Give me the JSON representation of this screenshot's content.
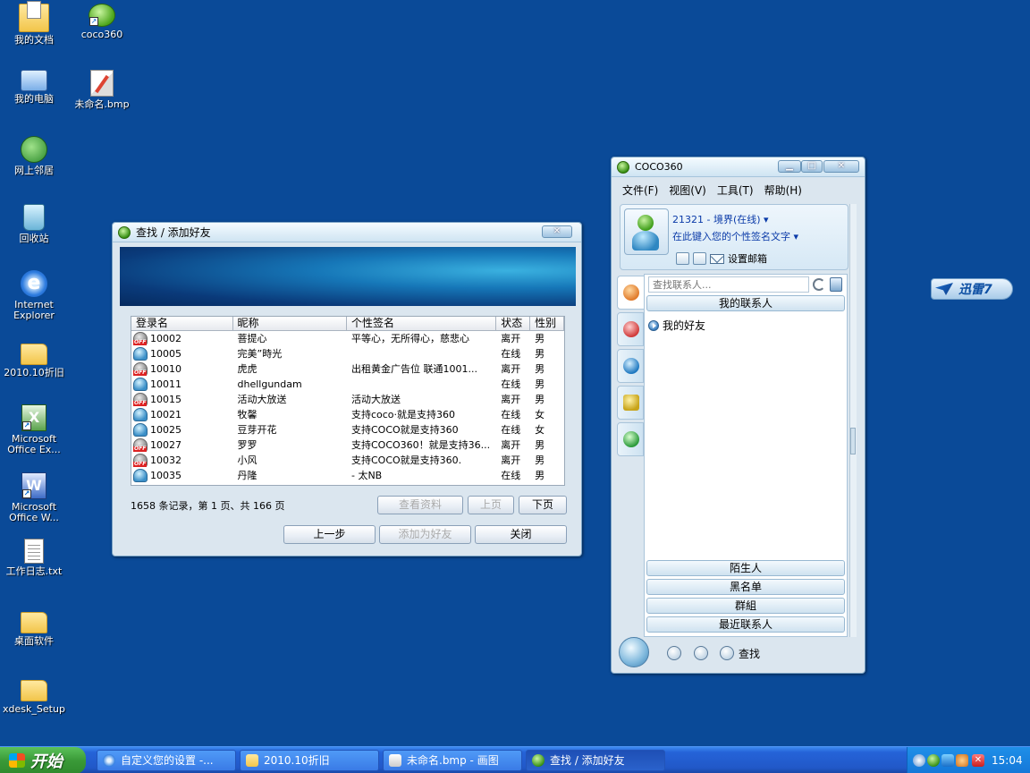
{
  "desktop": {
    "icons": [
      {
        "label": "我的文档",
        "icon": "my-documents-icon"
      },
      {
        "label": "coco360",
        "icon": "coco360-icon"
      },
      {
        "label": "我的电脑",
        "icon": "my-computer-icon"
      },
      {
        "label": "未命名.bmp",
        "icon": "bmp-file-icon"
      },
      {
        "label": "网上邻居",
        "icon": "network-icon"
      },
      {
        "label": "回收站",
        "icon": "recycle-bin-icon"
      },
      {
        "label": "Internet Explorer",
        "icon": "ie-icon"
      },
      {
        "label": "2010.10折旧",
        "icon": "folder-icon"
      },
      {
        "label": "Microsoft Office Ex...",
        "icon": "excel-icon"
      },
      {
        "label": "Microsoft Office W...",
        "icon": "word-icon"
      },
      {
        "label": "工作日志.txt",
        "icon": "text-file-icon"
      },
      {
        "label": "桌面软件",
        "icon": "folder-icon"
      },
      {
        "label": "xdesk_Setup",
        "icon": "folder-icon"
      }
    ]
  },
  "find_dialog": {
    "title": "查找 / 添加好友",
    "columns": [
      "登录名",
      "昵称",
      "个性签名",
      "状态",
      "性别"
    ],
    "rows": [
      {
        "id": "10002",
        "nick": "菩提心",
        "sig": "平等心，无所得心，慈悲心",
        "status": "离开",
        "gender": "男",
        "online": false
      },
      {
        "id": "10005",
        "nick": "完美”時光",
        "sig": "",
        "status": "在线",
        "gender": "男",
        "online": true
      },
      {
        "id": "10010",
        "nick": "虎虎",
        "sig": "出租黄金广告位 联通1001...",
        "status": "离开",
        "gender": "男",
        "online": false
      },
      {
        "id": "10011",
        "nick": "dhellgundam",
        "sig": "",
        "status": "在线",
        "gender": "男",
        "online": true
      },
      {
        "id": "10015",
        "nick": "活动大放送",
        "sig": "活动大放送",
        "status": "离开",
        "gender": "男",
        "online": false
      },
      {
        "id": "10021",
        "nick": "牧馨",
        "sig": "支持coco·就是支持360",
        "status": "在线",
        "gender": "女",
        "online": true
      },
      {
        "id": "10025",
        "nick": "豆芽开花",
        "sig": "支持COCO就是支持360",
        "status": "在线",
        "gender": "女",
        "online": true
      },
      {
        "id": "10027",
        "nick": "罗罗",
        "sig": "支持COCO360！就是支持36...",
        "status": "离开",
        "gender": "男",
        "online": false
      },
      {
        "id": "10032",
        "nick": "小风",
        "sig": "支持COCO就是支持360.",
        "status": "离开",
        "gender": "男",
        "online": false
      },
      {
        "id": "10035",
        "nick": "丹隆",
        "sig": "- 太NB",
        "status": "在线",
        "gender": "男",
        "online": true
      }
    ],
    "records_text": "1658 条记录，第 1 页、共 166 页",
    "buttons": {
      "view_profile": "查看资料",
      "prev_page": "上页",
      "next_page": "下页",
      "back": "上一步",
      "add_friend": "添加为好友",
      "close": "关闭"
    }
  },
  "coco": {
    "title": "COCO360",
    "menu": [
      "文件(F)",
      "视图(V)",
      "工具(T)",
      "帮助(H)"
    ],
    "user_line": "21321 - 境界(在线) ▾",
    "signature_prompt": "在此键入您的个性签名文字 ▾",
    "mail_label": "设置邮箱",
    "search_placeholder": "查找联系人...",
    "groups_top": "我的联系人",
    "friends_group": "我的好友",
    "groups_bottom": [
      "陌生人",
      "黑名单",
      "群組",
      "最近联系人"
    ],
    "find_label": "查找"
  },
  "xunlei": {
    "label": "迅雷7"
  },
  "taskbar": {
    "start_label": "开始",
    "tasks": [
      {
        "label": "自定义您的设置 -...",
        "icon": "ie-icon"
      },
      {
        "label": "2010.10折旧",
        "icon": "folder-icon"
      },
      {
        "label": "未命名.bmp - 画图",
        "icon": "paint-icon"
      },
      {
        "label": "查找 / 添加好友",
        "icon": "coco360-icon"
      }
    ],
    "clock": "15:04"
  }
}
